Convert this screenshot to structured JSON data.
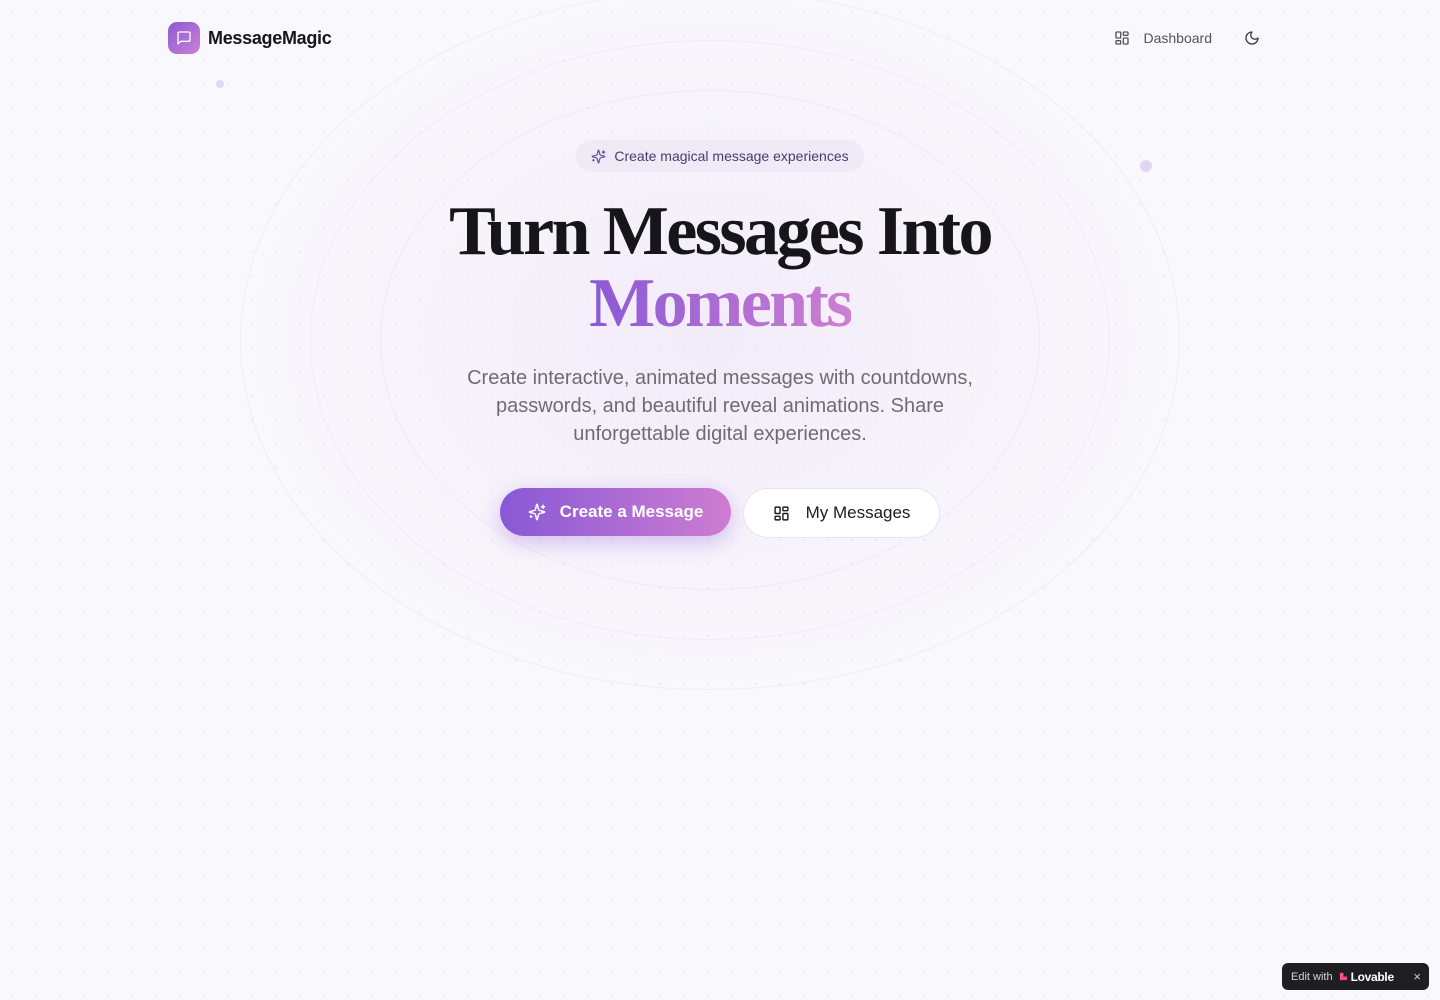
{
  "header": {
    "brand_name": "MessageMagic",
    "dashboard_label": "Dashboard"
  },
  "hero": {
    "badge": "Create magical message experiences",
    "title_line1": "Turn Messages Into",
    "title_line2": "Moments",
    "subtitle": "Create interactive, animated messages with countdowns, passwords, and beautiful reveal animations. Share unforgettable digital experiences.",
    "primary_button": "Create a Message",
    "secondary_button": "My Messages"
  },
  "lovable_badge": {
    "edit_label": "Edit with",
    "brand": "Lovable",
    "close": "×"
  },
  "colors": {
    "accent_start": "#8958d6",
    "accent_end": "#cd7dd1",
    "background": "#f9f8fc",
    "text": "#17171c",
    "muted_text": "#6d6c75"
  },
  "icons": {
    "logo": "message-square-icon",
    "dashboard": "layout-grid-icon",
    "theme": "moon-icon",
    "badge": "sparkles-icon",
    "primary_button": "sparkles-icon",
    "secondary_button": "layout-grid-icon",
    "close": "close-icon"
  }
}
